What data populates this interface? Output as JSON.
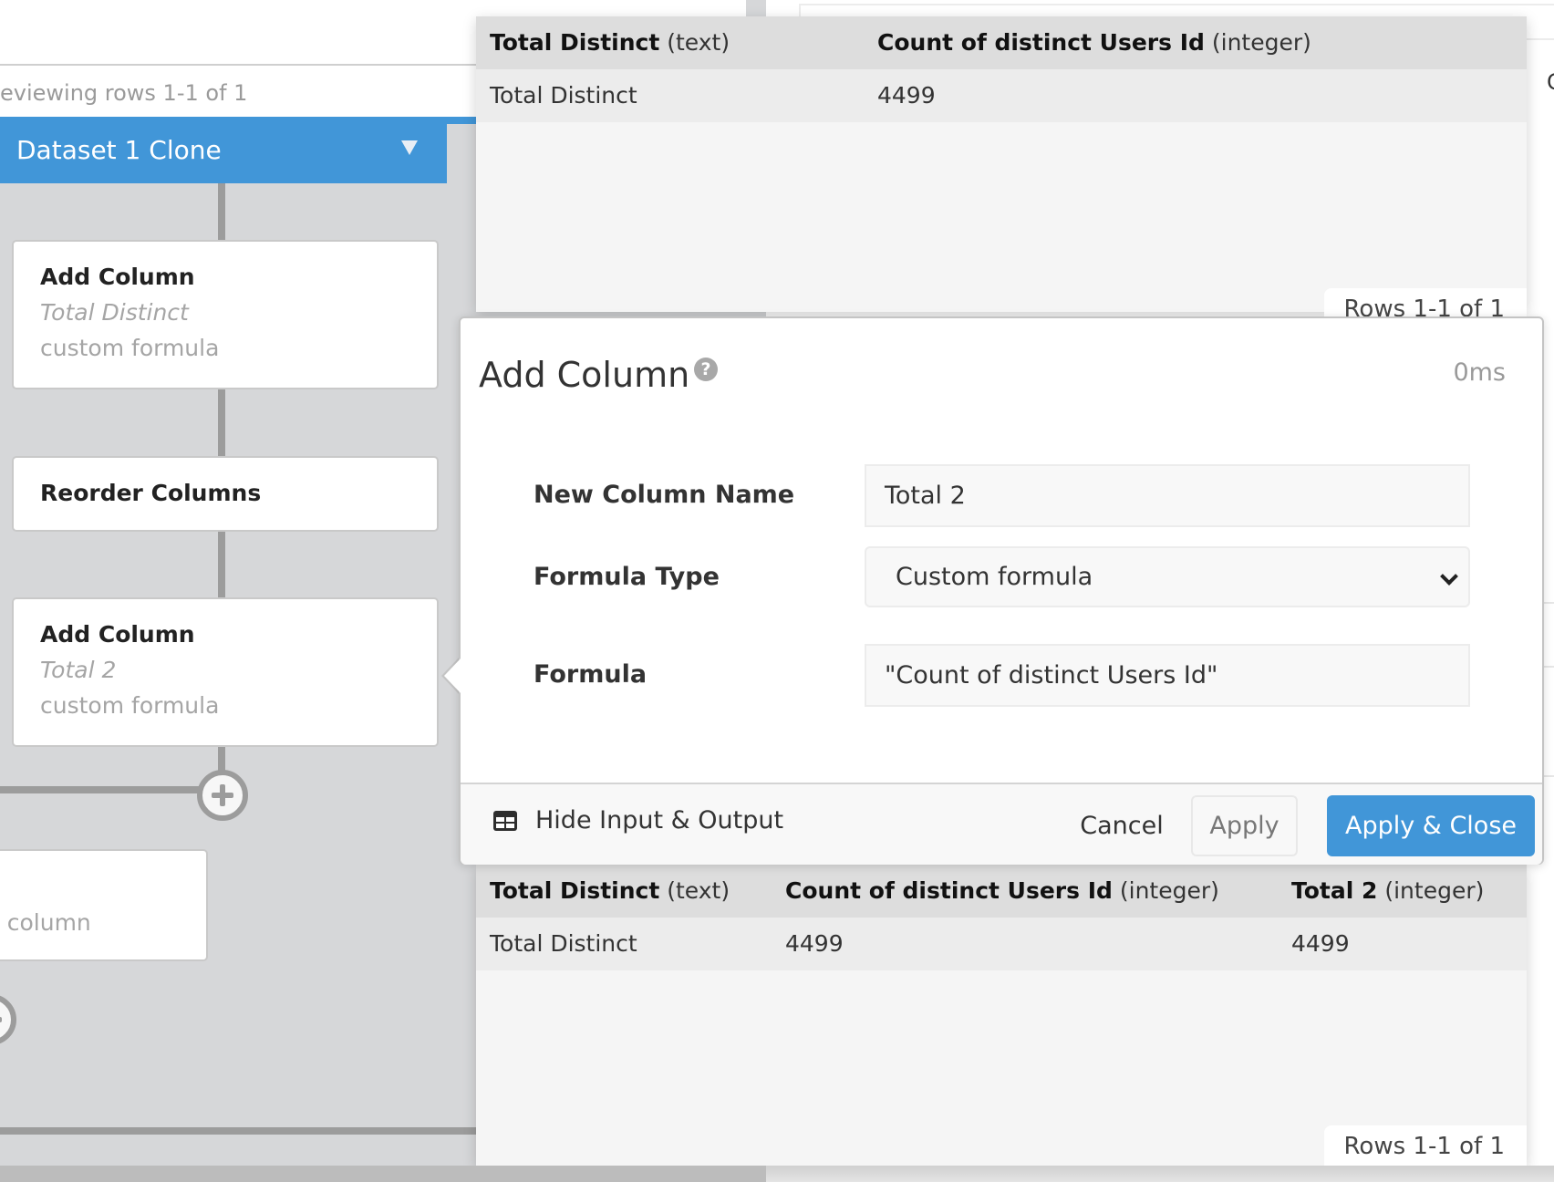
{
  "preview": {
    "rows_text": "eviewing rows 1-1 of 1"
  },
  "flow": {
    "dataset": {
      "label": "Dataset 1 Clone"
    },
    "steps": [
      {
        "title": "Add Column",
        "subtitle": "Total Distinct",
        "description": "custom formula"
      },
      {
        "title": "Reorder Columns"
      },
      {
        "title": "Add Column",
        "subtitle": "Total 2",
        "description": "custom formula"
      },
      {
        "description": "t column"
      }
    ]
  },
  "input_table": {
    "columns": [
      {
        "name": "Total Distinct",
        "type": "(text)"
      },
      {
        "name": "Count of distinct Users Id",
        "type": "(integer)"
      }
    ],
    "rows": [
      [
        "Total Distinct",
        "4499"
      ]
    ],
    "rows_label": "Rows 1-1 of 1"
  },
  "modal": {
    "title": "Add Column",
    "timing": "0ms",
    "fields": {
      "new_column_name": {
        "label": "New Column Name",
        "value": "Total 2"
      },
      "formula_type": {
        "label": "Formula Type",
        "value": "Custom formula"
      },
      "formula": {
        "label": "Formula",
        "value": "\"Count of distinct Users Id\""
      }
    },
    "footer": {
      "toggle_label": "Hide Input & Output",
      "cancel_label": "Cancel",
      "apply_label": "Apply",
      "apply_close_label": "Apply & Close"
    }
  },
  "output_table": {
    "columns": [
      {
        "name": "Total Distinct",
        "type": "(text)"
      },
      {
        "name": "Count of distinct Users Id",
        "type": "(integer)"
      },
      {
        "name": "Total 2",
        "type": "(integer)"
      }
    ],
    "rows": [
      [
        "Total Distinct",
        "4499",
        "4499"
      ]
    ],
    "rows_label": "Rows 1-1 of 1"
  },
  "background": {
    "partial_text": "C"
  },
  "colors": {
    "accent": "#4196d8",
    "panel": "#d6d7d9",
    "connector": "#9c9c9c"
  }
}
